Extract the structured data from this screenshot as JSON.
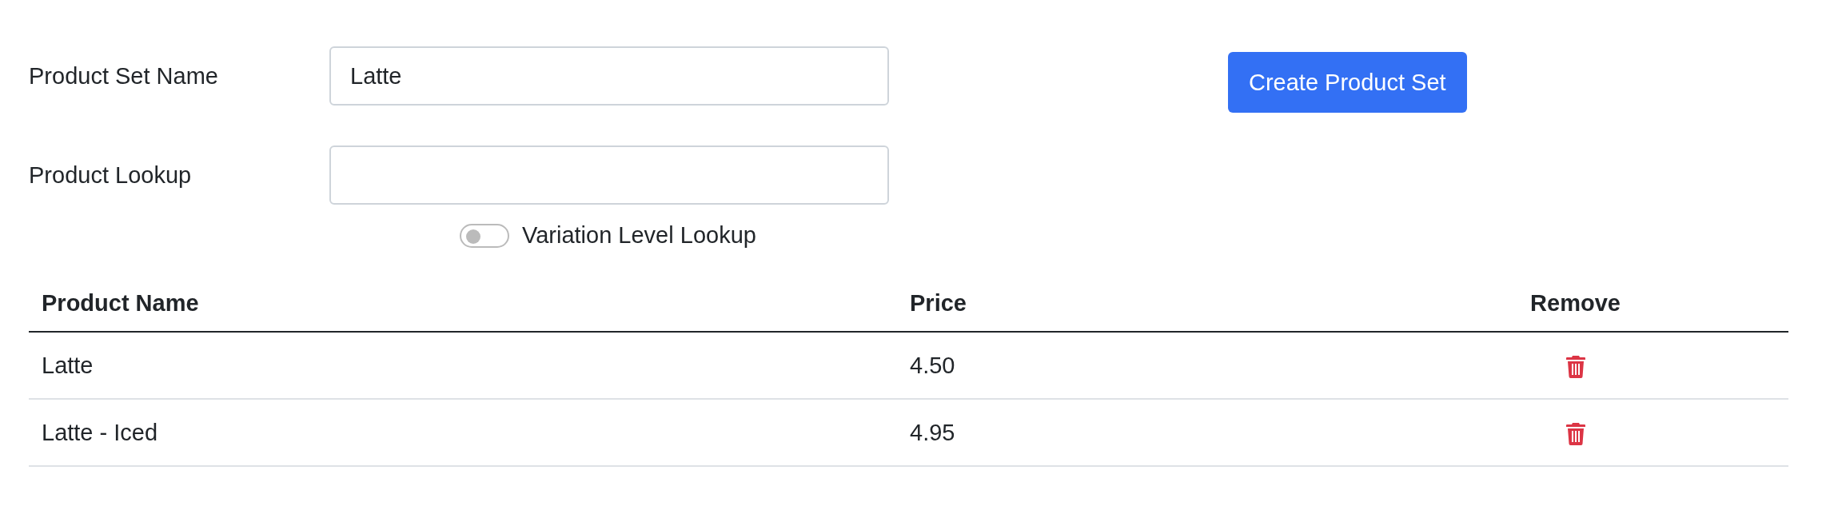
{
  "form": {
    "fields": [
      {
        "label": "Product Set Name",
        "value": "Latte"
      },
      {
        "label": "Product Lookup"
      }
    ],
    "toggle": {
      "label": "Variation Level Lookup",
      "on": false
    },
    "button": "Create Product Set"
  },
  "table": {
    "columns": [
      "Product Name",
      "Price",
      "Remove"
    ],
    "rows": [
      {
        "name": "Latte",
        "price": "4.50"
      },
      {
        "name": "Latte - Iced",
        "price": "4.95"
      }
    ]
  }
}
